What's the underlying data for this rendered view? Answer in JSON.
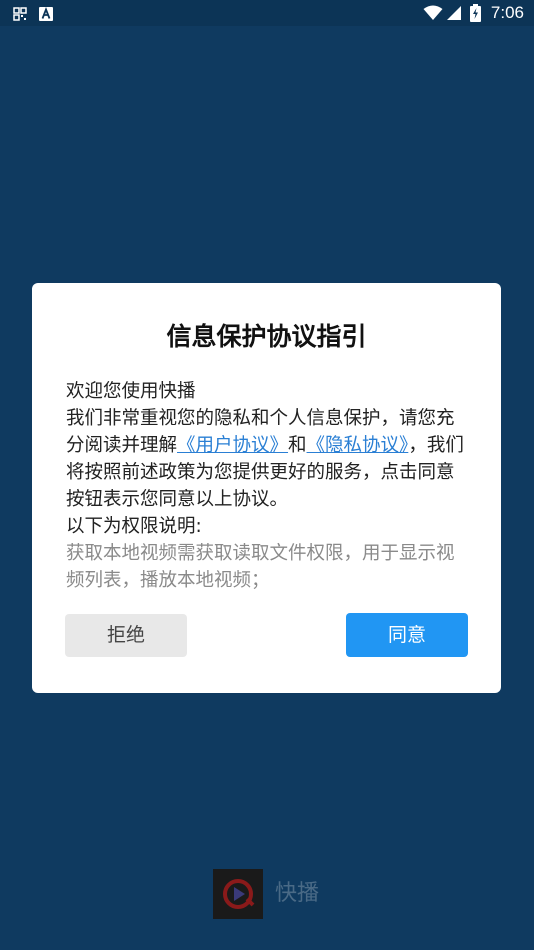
{
  "status_bar": {
    "time": "7:06"
  },
  "dialog": {
    "title": "信息保护协议指引",
    "welcome": "欢迎您使用快播",
    "para_part1": "我们非常重视您的隐私和个人信息保护，请您充分阅读并理解",
    "user_agreement_link": "《用户协议》",
    "and_text": "和",
    "privacy_link": "《隐私协议》",
    "para_part2": "，我们将按照前述政策为您提供更好的服务，点击同意按钮表示您同意以上协议。",
    "permission_heading": "以下为权限说明:",
    "permission_detail": "获取本地视频需获取读取文件权限，用于显示视频列表，播放本地视频；",
    "reject_label": "拒绝",
    "agree_label": "同意"
  },
  "splash": {
    "app_name": "快播"
  },
  "colors": {
    "background": "#0f3a60",
    "link": "#2a7fd4",
    "agree_button": "#2196f3",
    "reject_button": "#e8e8e8"
  }
}
